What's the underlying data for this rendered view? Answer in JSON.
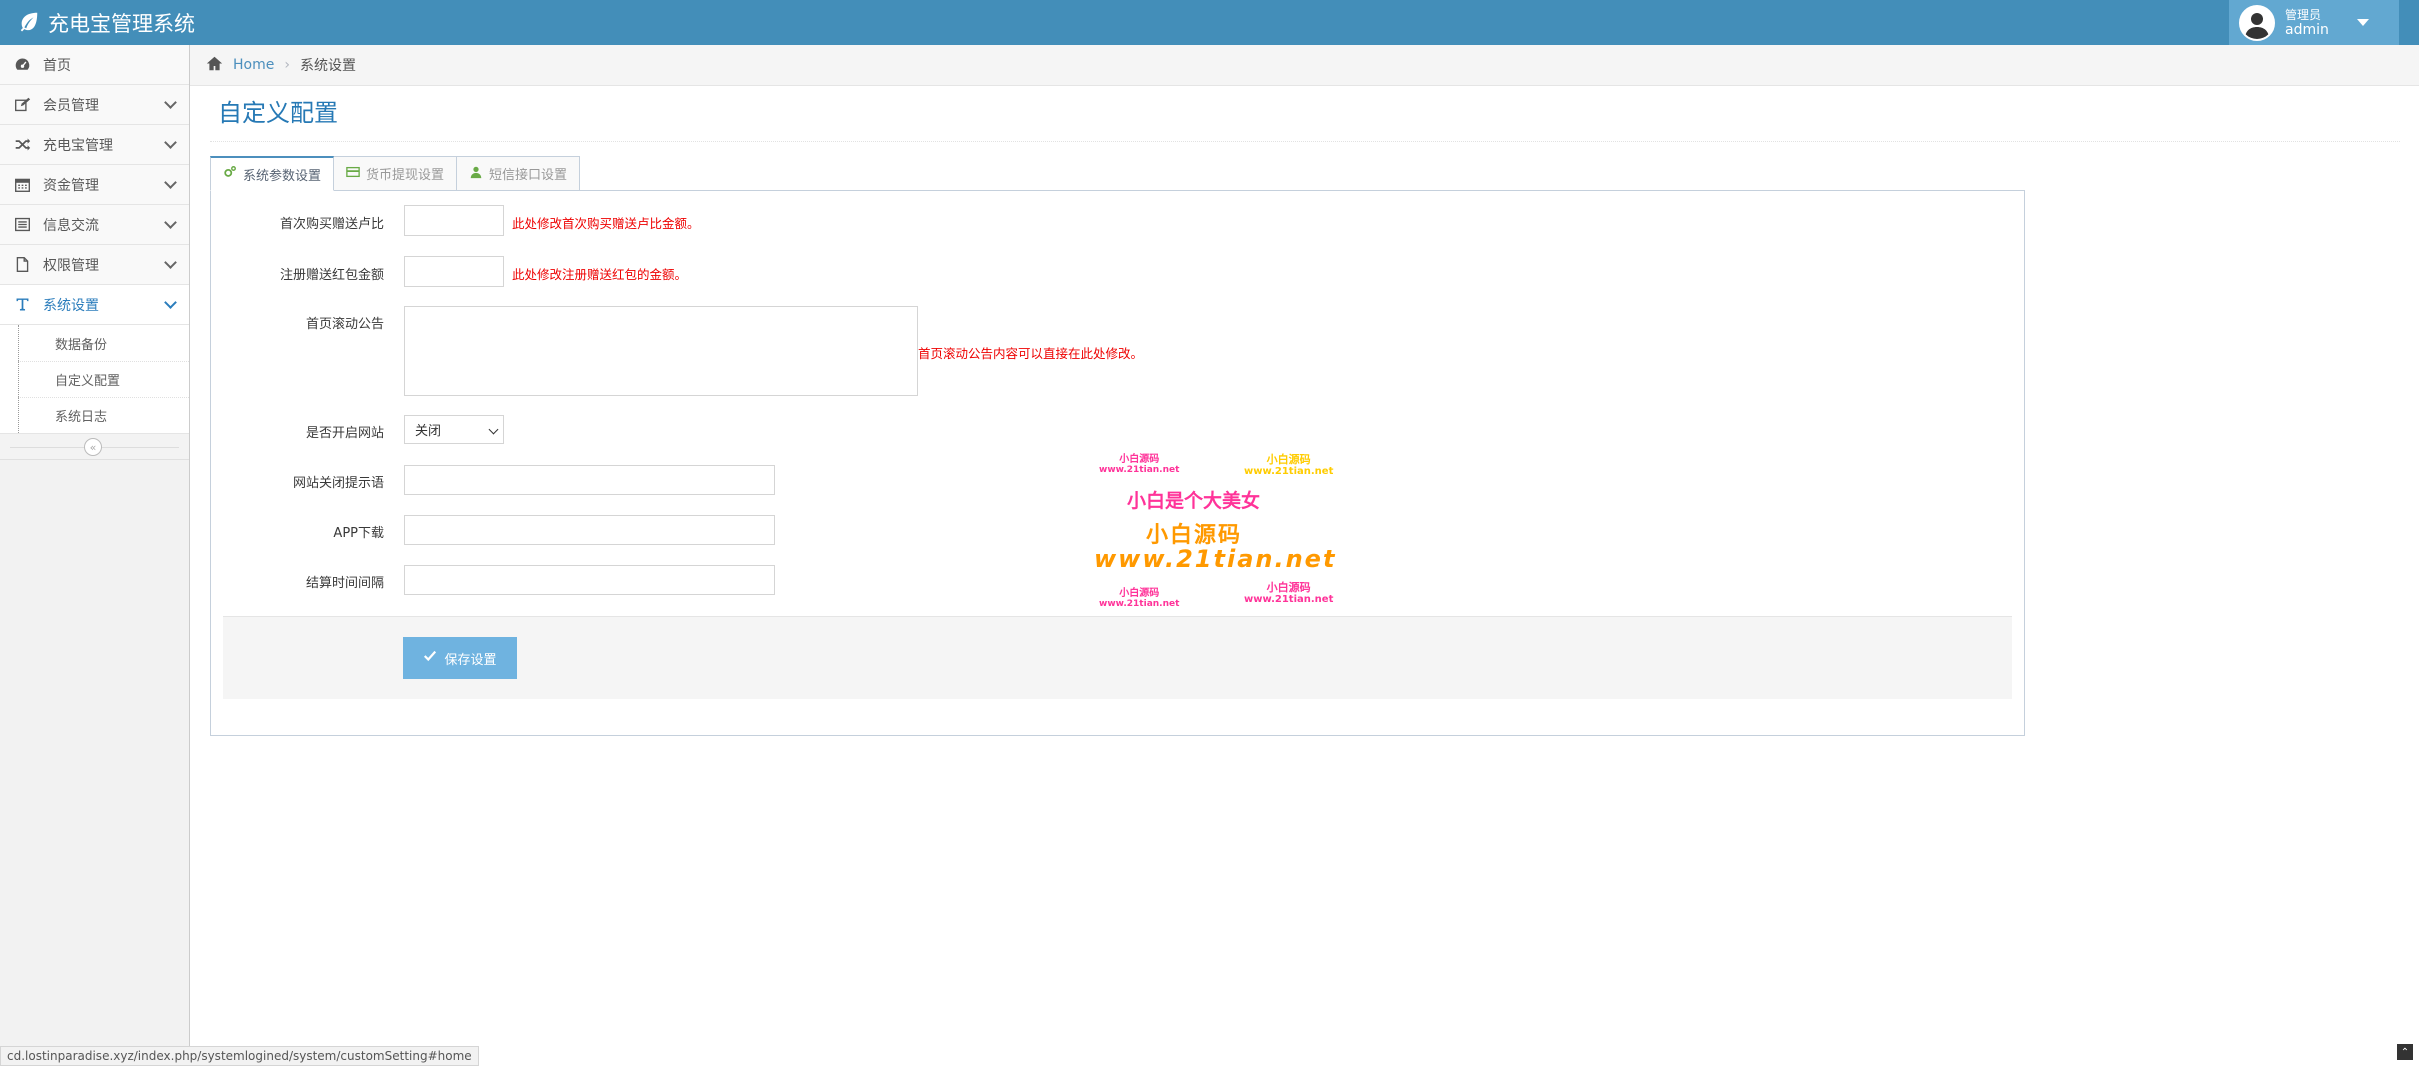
{
  "app": {
    "title": "充电宝管理系统"
  },
  "user": {
    "role": "管理员",
    "name": "admin"
  },
  "sidebar": {
    "items": [
      {
        "label": "首页",
        "icon": "dashboard-icon"
      },
      {
        "label": "会员管理",
        "icon": "edit-icon"
      },
      {
        "label": "充电宝管理",
        "icon": "shuffle-icon"
      },
      {
        "label": "资金管理",
        "icon": "calendar-icon"
      },
      {
        "label": "信息交流",
        "icon": "list-icon"
      },
      {
        "label": "权限管理",
        "icon": "file-icon"
      },
      {
        "label": "系统设置",
        "icon": "text-icon"
      }
    ],
    "sub_items": [
      {
        "label": "数据备份"
      },
      {
        "label": "自定义配置"
      },
      {
        "label": "系统日志"
      }
    ]
  },
  "breadcrumb": {
    "home": "Home",
    "current": "系统设置"
  },
  "page": {
    "title": "自定义配置"
  },
  "tabs": [
    {
      "label": "系统参数设置",
      "icon": "cogs-icon"
    },
    {
      "label": "货币提现设置",
      "icon": "credit-card-icon"
    },
    {
      "label": "短信接口设置",
      "icon": "user-icon"
    }
  ],
  "form": {
    "first_buy": {
      "label": "首次购买赠送卢比",
      "value": "",
      "help": "此处修改首次购买赠送卢比金额。"
    },
    "register_bonus": {
      "label": "注册赠送红包金额",
      "value": "",
      "help": "此处修改注册赠送红包的金额。"
    },
    "notice": {
      "label": "首页滚动公告",
      "value": "",
      "help": "首页滚动公告内容可以直接在此处修改。"
    },
    "site_open": {
      "label": "是否开启网站",
      "selected": "关闭"
    },
    "close_tip": {
      "label": "网站关闭提示语",
      "value": ""
    },
    "app_download": {
      "label": "APP下载",
      "value": ""
    },
    "settle_interval": {
      "label": "结算时间间隔",
      "value": ""
    },
    "save_label": "保存设置"
  },
  "watermark": {
    "small1": "小白源码",
    "small1_url": "www.21tian.net",
    "small2": "小白源码",
    "small2_url": "www.21tian.net",
    "slogan": "小白是个大美女",
    "big_name": "小白源码",
    "big_url": "www.21tian.net",
    "small3": "小白源码",
    "small3_url": "www.21tian.net",
    "small4": "小白源码",
    "small4_url": "www.21tian.net"
  },
  "status_url": "cd.lostinparadise.xyz/index.php/systemlogined/system/customSetting#home",
  "colors": {
    "navbar": "#438eb9",
    "accent": "#2679b5",
    "help": "#ee0000",
    "button": "#6fb3e0"
  }
}
